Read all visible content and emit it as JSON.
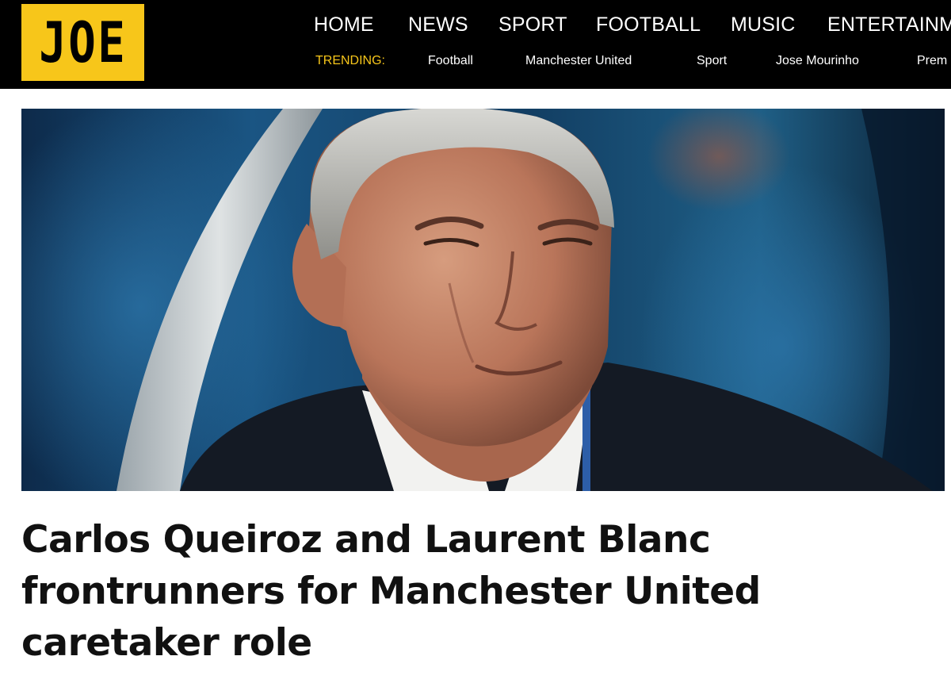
{
  "brand": {
    "logo_text": "JOE",
    "accent_color": "#f7c61a"
  },
  "nav": {
    "items": [
      {
        "label": "HOME"
      },
      {
        "label": "NEWS"
      },
      {
        "label": "SPORT"
      },
      {
        "label": "FOOTBALL"
      },
      {
        "label": "MUSIC"
      },
      {
        "label": "ENTERTAINM"
      }
    ]
  },
  "trending": {
    "label": "TRENDING:",
    "items": [
      {
        "label": "Football"
      },
      {
        "label": "Manchester United"
      },
      {
        "label": "Sport"
      },
      {
        "label": "Jose Mourinho"
      },
      {
        "label": "Prem"
      }
    ]
  },
  "article": {
    "headline_lines": [
      "Carlos Queiroz and Laurent Blanc",
      "frontrunners for Manchester United",
      "caretaker role"
    ],
    "hero_image": "photo of a grey-haired man in a dark jacket and white collar"
  }
}
